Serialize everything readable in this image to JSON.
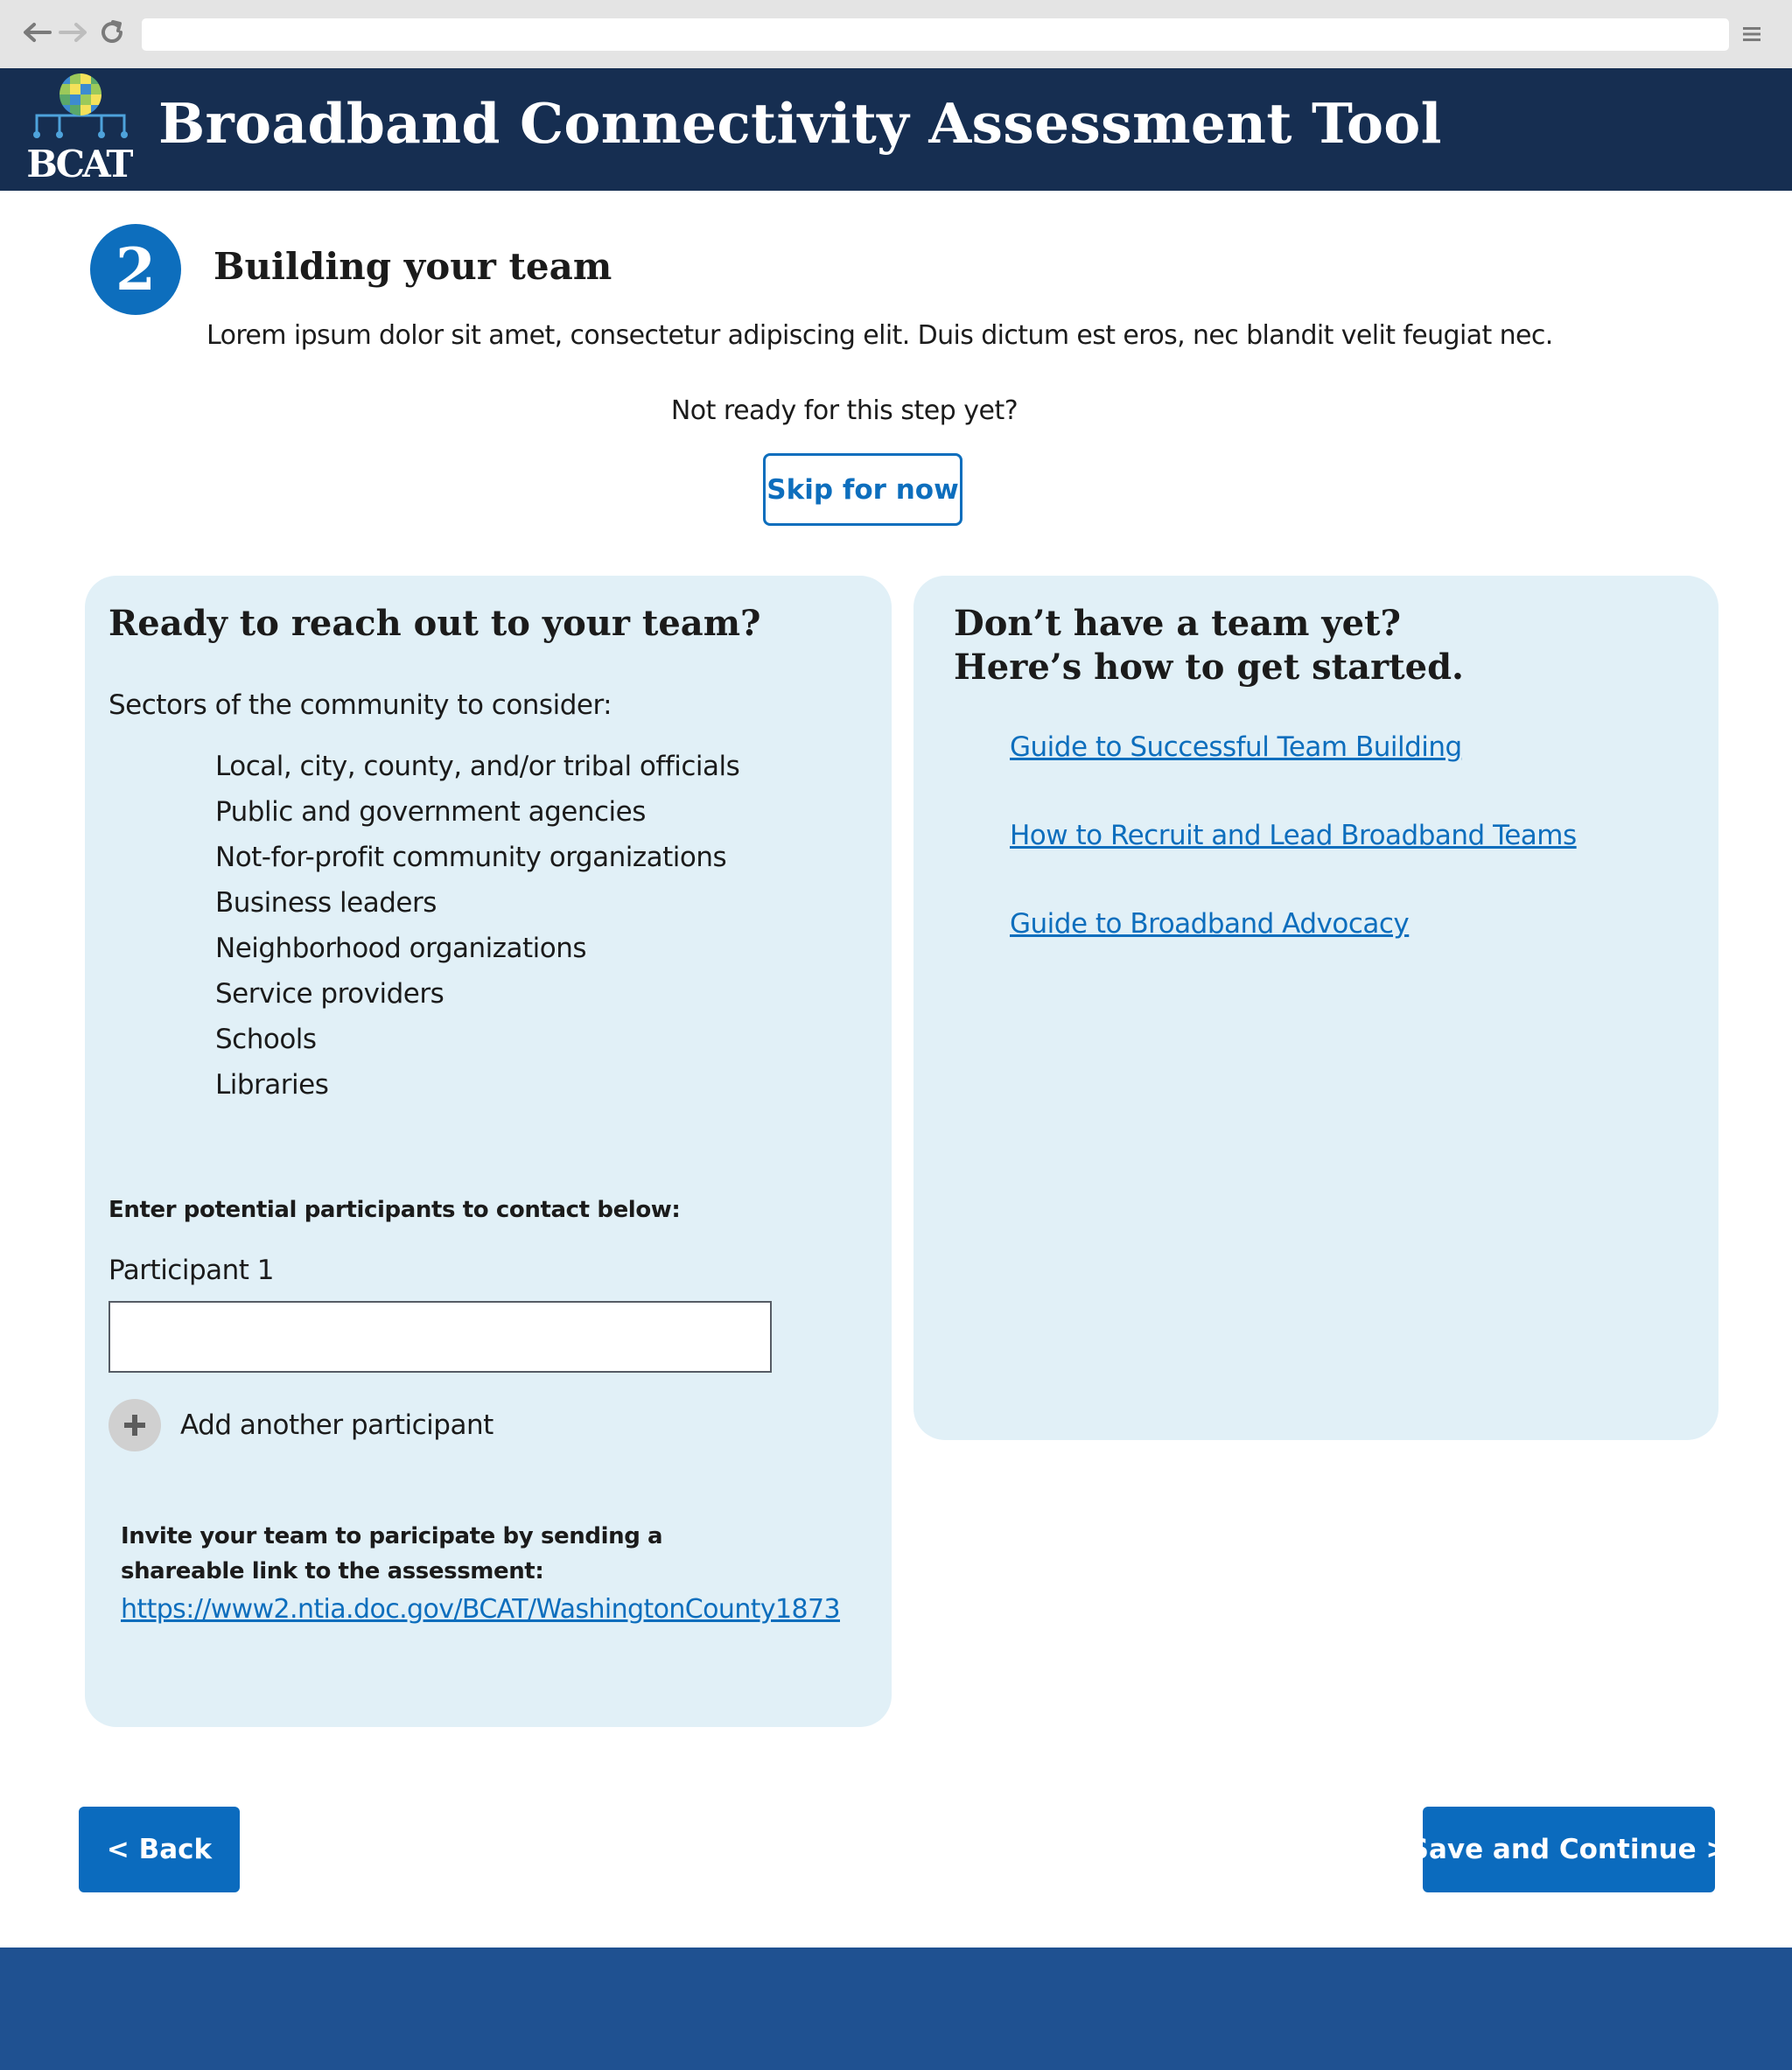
{
  "browser": {
    "back_icon": "arrow-left-icon",
    "forward_icon": "arrow-right-icon",
    "reload_icon": "reload-icon",
    "menu_icon": "hamburger-menu-icon",
    "url": ""
  },
  "header": {
    "logo_text": "BCAT",
    "title": "Broadband Connectivity Assessment Tool"
  },
  "step": {
    "number": "2",
    "title": "Building your team",
    "description": "Lorem ipsum dolor sit amet, consectetur adipiscing elit. Duis dictum est eros, nec blandit velit feugiat nec.",
    "not_ready_text": "Not ready for this step yet?",
    "skip_label": "Skip for now"
  },
  "left_panel": {
    "heading": "Ready to reach out to your team?",
    "sectors_intro": "Sectors of the community to consider:",
    "sectors": [
      "Local, city, county, and/or tribal officials",
      "Public and government agencies",
      "Not-for-profit community organizations",
      "Business leaders",
      "Neighborhood organizations",
      "Service providers",
      "Schools",
      "Libraries"
    ],
    "enter_label": "Enter potential participants to contact below:",
    "participant_label": "Participant 1",
    "participant_value": "",
    "add_label": "Add another participant",
    "invite_text": "Invite your team to paricipate by sending a shareable link to the assessment:",
    "share_link": "https://www2.ntia.doc.gov/BCAT/WashingtonCounty1873"
  },
  "right_panel": {
    "heading_line1": "Don’t have a team yet?",
    "heading_line2": "Here’s how to get started.",
    "links": [
      "Guide to Successful Team Building",
      "How to Recruit and Lead Broadband Teams",
      "Guide to Broadband Advocacy"
    ]
  },
  "nav": {
    "back_label": "< Back",
    "continue_label": "Save and Continue >"
  },
  "colors": {
    "banner": "#162e51",
    "primary": "#0d6ebd",
    "panel_bg": "#e1f0f7",
    "footer": "#1f5191"
  }
}
